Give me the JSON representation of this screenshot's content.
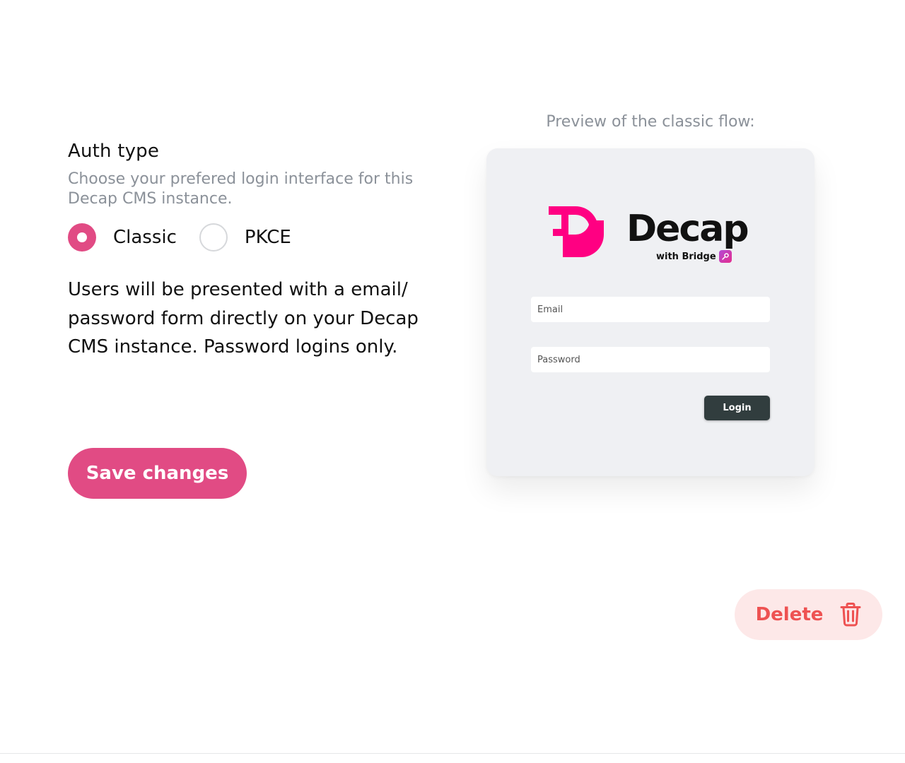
{
  "auth": {
    "title": "Auth type",
    "description": "Choose your prefered login interface for this Decap CMS instance.",
    "options": [
      {
        "label": "Classic",
        "selected": true
      },
      {
        "label": "PKCE",
        "selected": false
      }
    ],
    "explanation": "Users will be presented with a email/ password form directly on your Decap CMS instance. Password logins only.",
    "save_label": "Save changes"
  },
  "preview": {
    "caption": "Preview of the classic flow:",
    "logo_text": "Decap",
    "logo_subtext": "with Bridge",
    "email_placeholder": "Email",
    "password_placeholder": "Password",
    "login_label": "Login"
  },
  "delete": {
    "label": "Delete",
    "icon": "trash-icon"
  },
  "colors": {
    "accent": "#e14b84",
    "danger": "#ee5252",
    "danger_bg": "#fde8e8",
    "muted": "#8b9199",
    "decap_pink": "#ff0082"
  }
}
